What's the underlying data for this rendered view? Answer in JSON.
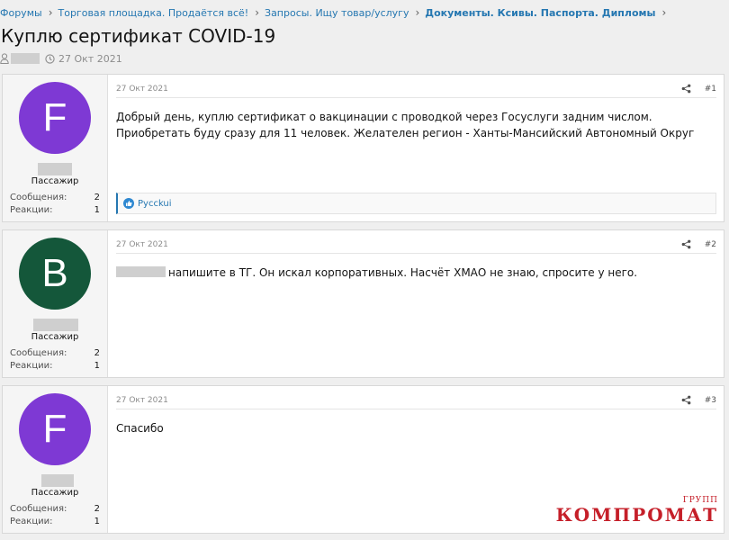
{
  "breadcrumbs": [
    {
      "label": "Форумы"
    },
    {
      "label": "Торговая площадка. Продаётся всё!"
    },
    {
      "label": "Запросы. Ищу товар/услугу"
    },
    {
      "label": "Документы. Ксивы. Паспорта. Дипломы"
    }
  ],
  "thread": {
    "title": "Куплю сертификат COVID-19",
    "date": "27 Окт 2021"
  },
  "labels": {
    "messages": "Сообщения:",
    "reactions": "Реакции:"
  },
  "posts": [
    {
      "avatar_letter": "F",
      "avatar_color": "#7e39d4",
      "user_title": "Пассажир",
      "messages": "2",
      "reactions": "1",
      "date": "27 Окт 2021",
      "number": "#1",
      "text": "Добрый день, куплю сертификат о вакцинации с проводкой через Госуслуги задним числом. Приобретать буду сразу для 11 человек. Желателен регион - Ханты-Мансийский Автономный Округ",
      "reaction_user": "Pycckui"
    },
    {
      "avatar_letter": "B",
      "avatar_color": "#14573a",
      "user_title": "Пассажир",
      "messages": "2",
      "reactions": "1",
      "date": "27 Окт 2021",
      "number": "#2",
      "text": "напишите в ТГ. Он искал корпоративных. Насчёт ХМАО не знаю, спросите у него."
    },
    {
      "avatar_letter": "F",
      "avatar_color": "#7e39d4",
      "user_title": "Пассажир",
      "messages": "2",
      "reactions": "1",
      "date": "27 Окт 2021",
      "number": "#3",
      "text": "Спасибо"
    }
  ],
  "watermark": {
    "main": "КОМПРОМАТ",
    "sub": "ГРУПП"
  }
}
